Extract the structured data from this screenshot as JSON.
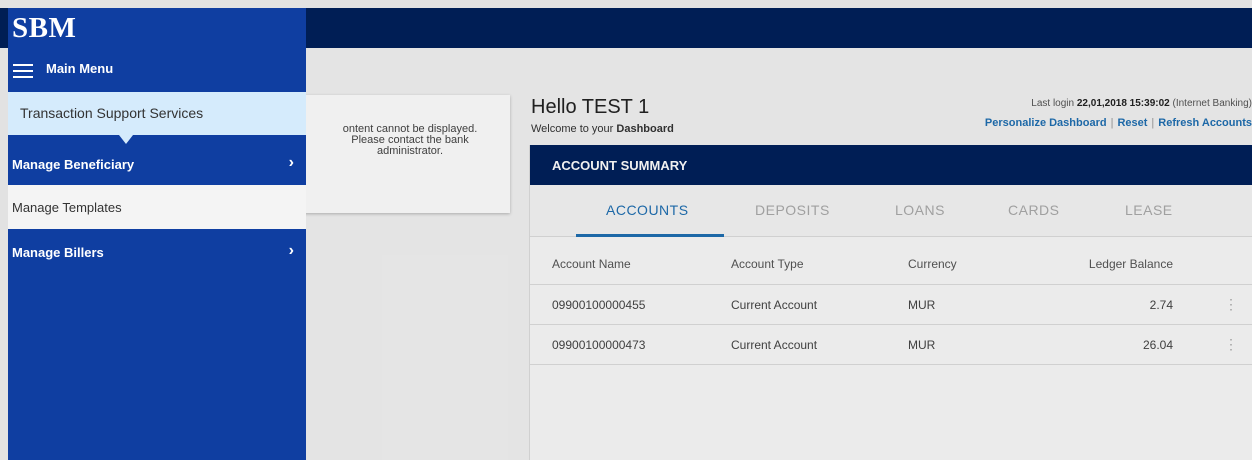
{
  "brand": {
    "logo_text": "SBM"
  },
  "menu": {
    "title": "Main Menu",
    "items": [
      {
        "label": "Transaction Support Services"
      },
      {
        "label": "Manage Beneficiary",
        "chevron": "›"
      },
      {
        "label": "Manage Templates"
      },
      {
        "label": "Manage Billers",
        "chevron": "›"
      }
    ]
  },
  "error_widget": {
    "lines": [
      "ontent cannot be displayed.",
      "Please contact the bank",
      "administrator."
    ]
  },
  "dashboard": {
    "greeting": "Hello TEST 1",
    "welcome_prefix": "Welcome to your",
    "welcome_bold": "Dashboard",
    "last_login_prefix": "Last login",
    "last_login_value": "22,01,2018 15:39:02",
    "last_login_suffix": "(Internet Banking)",
    "links": {
      "personalize": "Personalize Dashboard",
      "sep": "|",
      "reset": "Reset",
      "refresh": "Refresh Accounts"
    }
  },
  "account_summary": {
    "title": "ACCOUNT SUMMARY",
    "tabs": [
      "ACCOUNTS",
      "DEPOSITS",
      "LOANS",
      "CARDS",
      "LEASE"
    ],
    "active_tab": "ACCOUNTS",
    "columns": [
      "Account Name",
      "Account Type",
      "Currency",
      "Ledger Balance"
    ],
    "rows": [
      {
        "name": "09900100000455",
        "type": "Current Account",
        "currency": "MUR",
        "balance": "2.74",
        "more": "⋮"
      },
      {
        "name": "09900100000473",
        "type": "Current Account",
        "currency": "MUR",
        "balance": "26.04",
        "more": "⋮"
      }
    ]
  },
  "colors": {
    "navy": "#00205b",
    "menu_blue": "#0f3ea1",
    "highlight": "#d5ebfc",
    "link_blue": "#1f6fb2"
  }
}
